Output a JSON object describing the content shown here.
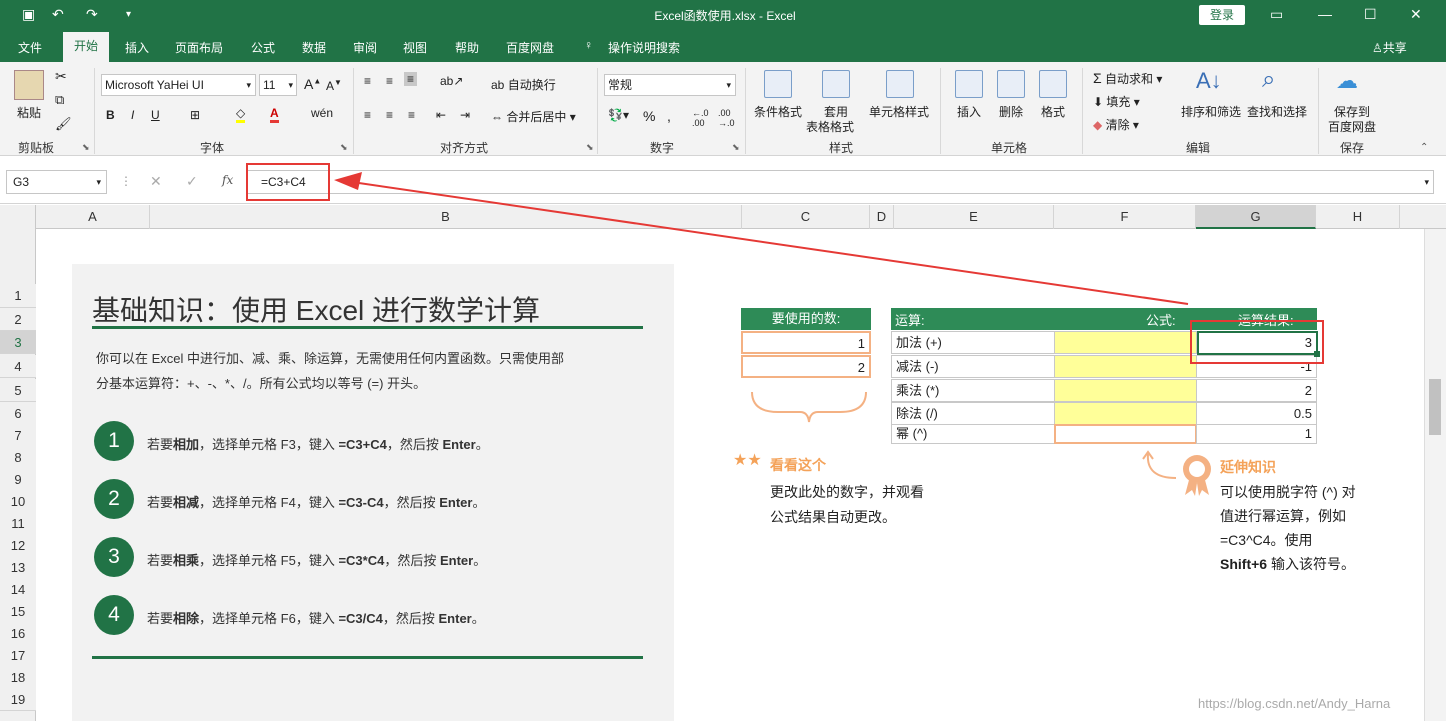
{
  "titlebar": {
    "title": "Excel函数使用.xlsx  -  Excel",
    "login": "登录"
  },
  "menu": [
    {
      "label": "文件",
      "name": "menu-file"
    },
    {
      "label": "开始",
      "name": "menu-home"
    },
    {
      "label": "插入",
      "name": "menu-insert"
    },
    {
      "label": "页面布局",
      "name": "menu-page-layout"
    },
    {
      "label": "公式",
      "name": "menu-formulas"
    },
    {
      "label": "数据",
      "name": "menu-data"
    },
    {
      "label": "审阅",
      "name": "menu-review"
    },
    {
      "label": "视图",
      "name": "menu-view"
    },
    {
      "label": "帮助",
      "name": "menu-help"
    },
    {
      "label": "百度网盘",
      "name": "menu-baidu"
    },
    {
      "label": "操作说明搜索",
      "name": "menu-tell-me"
    }
  ],
  "share": "共享",
  "ribbon": {
    "paste": "粘贴",
    "clipboard": "剪贴板",
    "font_name": "Microsoft YaHei UI",
    "font_size": "11",
    "font_group": "字体",
    "wrap": "自动换行",
    "merge": "合并后居中",
    "align_group": "对齐方式",
    "num_format": "常规",
    "number_group": "数字",
    "cond_format": "条件格式",
    "table_format_1": "套用",
    "table_format_2": "表格格式",
    "cell_style": "单元格样式",
    "style_group": "样式",
    "insert": "插入",
    "delete": "删除",
    "format": "格式",
    "cells_group": "单元格",
    "autosum": "自动求和",
    "fill": "填充",
    "clear": "清除",
    "sort": "排序和筛选",
    "find": "查找和选择",
    "edit_group": "编辑",
    "save_1": "保存到",
    "save_2": "百度网盘",
    "save_group": "保存"
  },
  "formula_bar": {
    "name_box": "G3",
    "formula": "=C3+C4"
  },
  "columns": [
    "A",
    "B",
    "C",
    "D",
    "E",
    "F",
    "G",
    "H"
  ],
  "rows": [
    "1",
    "2",
    "3",
    "4",
    "5",
    "6",
    "7",
    "8",
    "9",
    "10",
    "11",
    "12",
    "13",
    "14",
    "15",
    "16",
    "17",
    "18",
    "19"
  ],
  "sheet": {
    "title": "基础知识：使用 Excel 进行数学计算",
    "para1": "你可以在 Excel 中进行加、减、乘、除运算，无需使用任何内置函数。只需使用部",
    "para2": "分基本运算符：+、-、*、/。所有公式均以等号 (=) 开头。",
    "steps": [
      {
        "num": "1",
        "pre": "若要",
        "op": "相加",
        "mid": "，选择单元格 F3，键入 ",
        "formula": "=C3+C4",
        "post": "，然后按 ",
        "key": "Enter",
        "end": "。"
      },
      {
        "num": "2",
        "pre": "若要",
        "op": "相减",
        "mid": "，选择单元格 F4，键入 ",
        "formula": "=C3-C4",
        "post": "，然后按 ",
        "key": "Enter",
        "end": "。"
      },
      {
        "num": "3",
        "pre": "若要",
        "op": "相乘",
        "mid": "，选择单元格 F5，键入 ",
        "formula": "=C3*C4",
        "post": "，然后按 ",
        "key": "Enter",
        "end": "。"
      },
      {
        "num": "4",
        "pre": "若要",
        "op": "相除",
        "mid": "，选择单元格 F6，键入 ",
        "formula": "=C3/C4",
        "post": "，然后按 ",
        "key": "Enter",
        "end": "。"
      }
    ],
    "numbers_header": "要使用的数:",
    "numbers": [
      "1",
      "2"
    ],
    "ops_header": "运算:",
    "formula_header": "公式:",
    "result_header": "运算结果:",
    "ops": [
      {
        "label": "加法 (+)",
        "result": "3"
      },
      {
        "label": "减法 (-)",
        "result": "-1"
      },
      {
        "label": "乘法 (*)",
        "result": "2"
      },
      {
        "label": "除法 (/)",
        "result": "0.5"
      },
      {
        "label": "幂 (^)",
        "result": "1"
      }
    ],
    "look_title": "看看这个",
    "look_1": "更改此处的数字，并观看",
    "look_2": "公式结果自动更改。",
    "ext_title": "延伸知识",
    "ext_1": "可以使用脱字符 (^) 对",
    "ext_2": "值进行幂运算，例如",
    "ext_3": "=C3^C4。使用",
    "ext_4_bold": "Shift+6",
    "ext_4_rest": " 输入该符号。"
  },
  "watermark": "https://blog.csdn.net/Andy_Harna"
}
